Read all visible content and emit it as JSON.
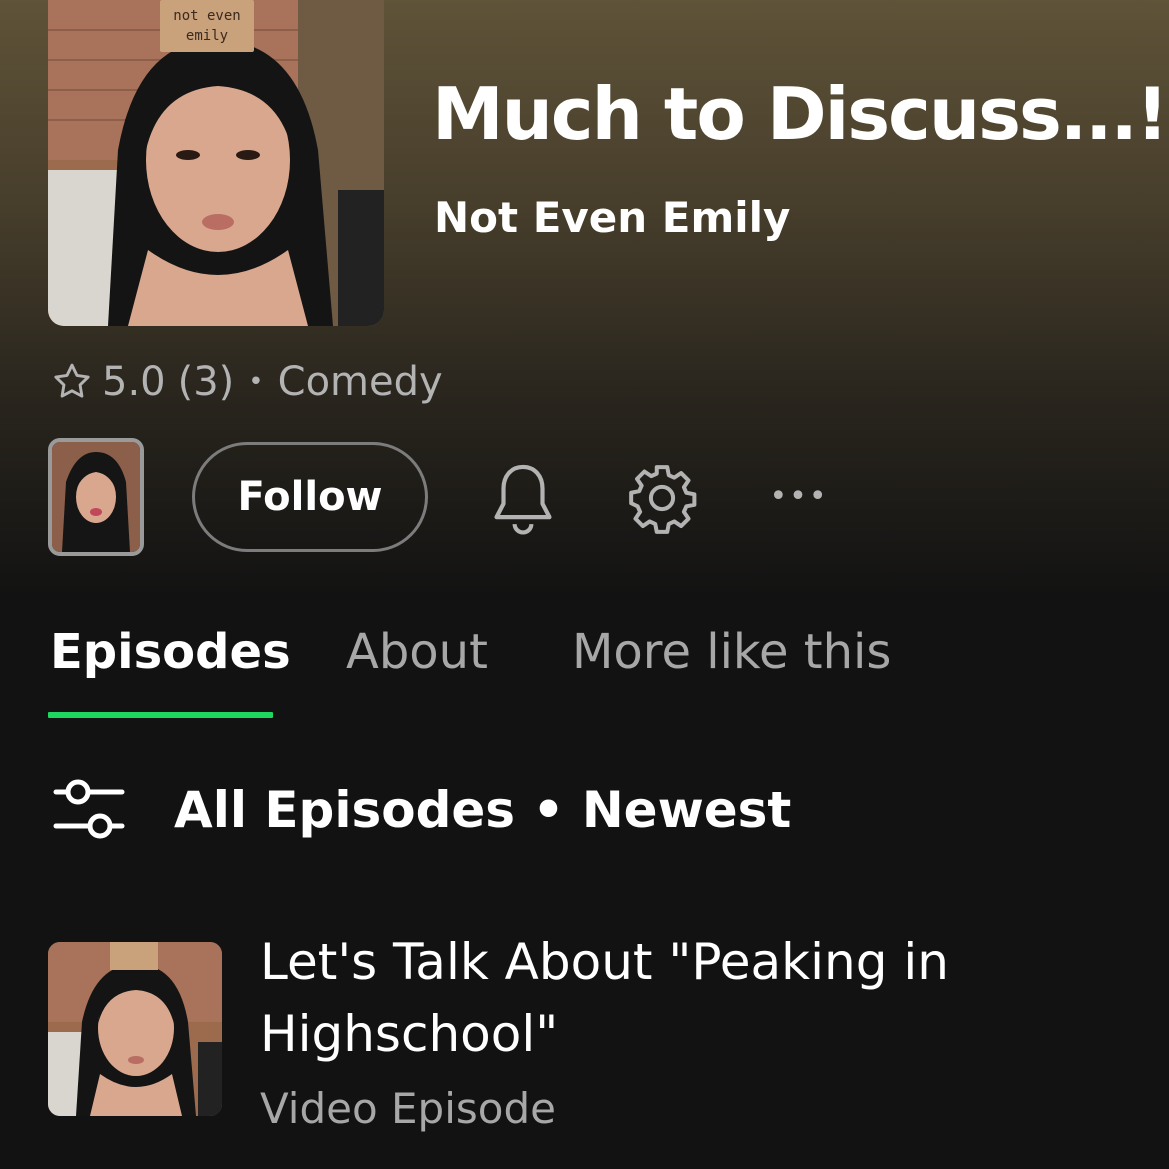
{
  "podcast": {
    "title": "Much to Discuss...!",
    "author": "Not Even Emily",
    "cover_sign_text": "not even emily",
    "rating": "5.0",
    "rating_count": "(3)",
    "separator": "•",
    "category": "Comedy"
  },
  "actions": {
    "follow_label": "Follow",
    "more_label": "•••",
    "icons": [
      "author-thumbnail",
      "bell-icon",
      "gear-icon",
      "more-icon"
    ]
  },
  "tabs": [
    {
      "label": "Episodes",
      "active": true
    },
    {
      "label": "About",
      "active": false
    },
    {
      "label": "More like this",
      "active": false
    }
  ],
  "filter": {
    "label": "All Episodes • Newest",
    "icon": "sliders-icon"
  },
  "episodes": [
    {
      "title": "Let's Talk About \"Peaking in Highschool\"",
      "type": "Video Episode"
    }
  ],
  "colors": {
    "accent": "#1ed760",
    "background": "#121212",
    "hero": "#5f5338",
    "muted_text": "#a7a7a7"
  }
}
